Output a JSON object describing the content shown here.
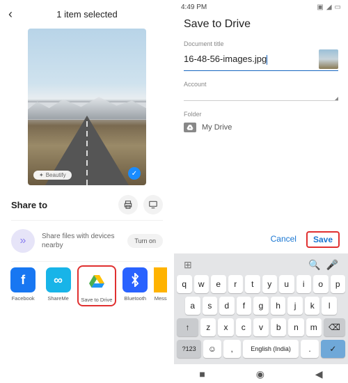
{
  "left": {
    "header_title": "1 item selected",
    "beautify_label": "Beautify",
    "share_to": "Share to",
    "nearby_text": "Share files with devices nearby",
    "turn_on": "Turn on",
    "apps": {
      "facebook": "Facebook",
      "shareme": "ShareMe",
      "drive": "Save to Drive",
      "bluetooth": "Bluetooth",
      "messenger": "Mess"
    }
  },
  "right": {
    "status_time": "4:49 PM",
    "title": "Save to Drive",
    "doc_label": "Document title",
    "doc_value": "16-48-56-images.jpg",
    "account_label": "Account",
    "folder_label": "Folder",
    "folder_value": "My Drive",
    "cancel": "Cancel",
    "save": "Save",
    "keyboard": {
      "row1": [
        "q",
        "w",
        "e",
        "r",
        "t",
        "y",
        "u",
        "i",
        "o",
        "p"
      ],
      "row2": [
        "a",
        "s",
        "d",
        "f",
        "g",
        "h",
        "j",
        "k",
        "l"
      ],
      "row3_shift": "↑",
      "row3": [
        "z",
        "x",
        "c",
        "v",
        "b",
        "n",
        "m"
      ],
      "row3_bksp": "⌫",
      "sym": "?123",
      "emoji": "☺",
      "comma": ",",
      "space": "English (India)",
      "period": ".",
      "enter": "✓"
    }
  }
}
